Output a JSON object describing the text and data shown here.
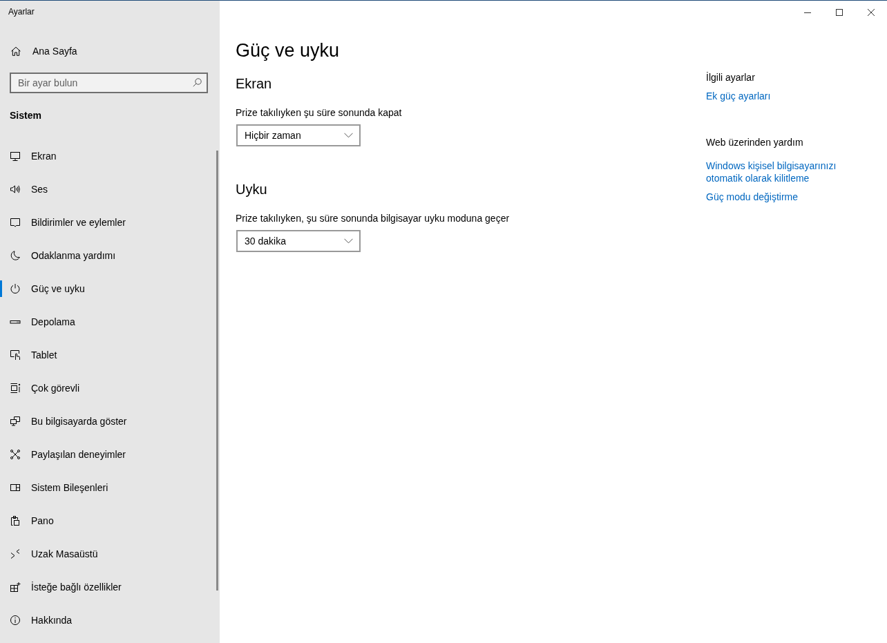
{
  "window": {
    "title": "Ayarlar"
  },
  "sidebar": {
    "home": {
      "label": "Ana Sayfa"
    },
    "search": {
      "placeholder": "Bir ayar bulun"
    },
    "section": "Sistem",
    "items": [
      {
        "label": "Ekran",
        "kind": "display",
        "selected": false
      },
      {
        "label": "Ses",
        "kind": "sound",
        "selected": false
      },
      {
        "label": "Bildirimler ve eylemler",
        "kind": "notifications",
        "selected": false
      },
      {
        "label": "Odaklanma yardımı",
        "kind": "focus",
        "selected": false
      },
      {
        "label": "Güç ve uyku",
        "kind": "power",
        "selected": true
      },
      {
        "label": "Depolama",
        "kind": "storage",
        "selected": false
      },
      {
        "label": "Tablet",
        "kind": "tablet",
        "selected": false
      },
      {
        "label": "Çok görevli",
        "kind": "multitasking",
        "selected": false
      },
      {
        "label": "Bu bilgisayarda göster",
        "kind": "projecting",
        "selected": false
      },
      {
        "label": "Paylaşılan deneyimler",
        "kind": "shared",
        "selected": false
      },
      {
        "label": "Sistem Bileşenleri",
        "kind": "components",
        "selected": false
      },
      {
        "label": "Pano",
        "kind": "clipboard",
        "selected": false
      },
      {
        "label": "Uzak Masaüstü",
        "kind": "remote",
        "selected": false
      },
      {
        "label": "İsteğe bağlı özellikler",
        "kind": "optional",
        "selected": false
      },
      {
        "label": "Hakkında",
        "kind": "about",
        "selected": false
      }
    ]
  },
  "main": {
    "title": "Güç ve uyku",
    "sections": [
      {
        "heading": "Ekran",
        "settings": [
          {
            "label": "Prize takılıyken şu süre sonunda kapat",
            "value": "Hiçbir zaman"
          }
        ]
      },
      {
        "heading": "Uyku",
        "settings": [
          {
            "label": "Prize takılıyken, şu süre sonunda bilgisayar uyku moduna geçer",
            "value": "30 dakika"
          }
        ]
      }
    ]
  },
  "related": [
    {
      "heading": "İlgili ayarlar",
      "links": [
        "Ek güç ayarları"
      ]
    },
    {
      "heading": "Web üzerinden yardım",
      "links": [
        "Windows kişisel bilgisayarınızı otomatik olarak kilitleme",
        "Güç modu değiştirme"
      ]
    }
  ]
}
